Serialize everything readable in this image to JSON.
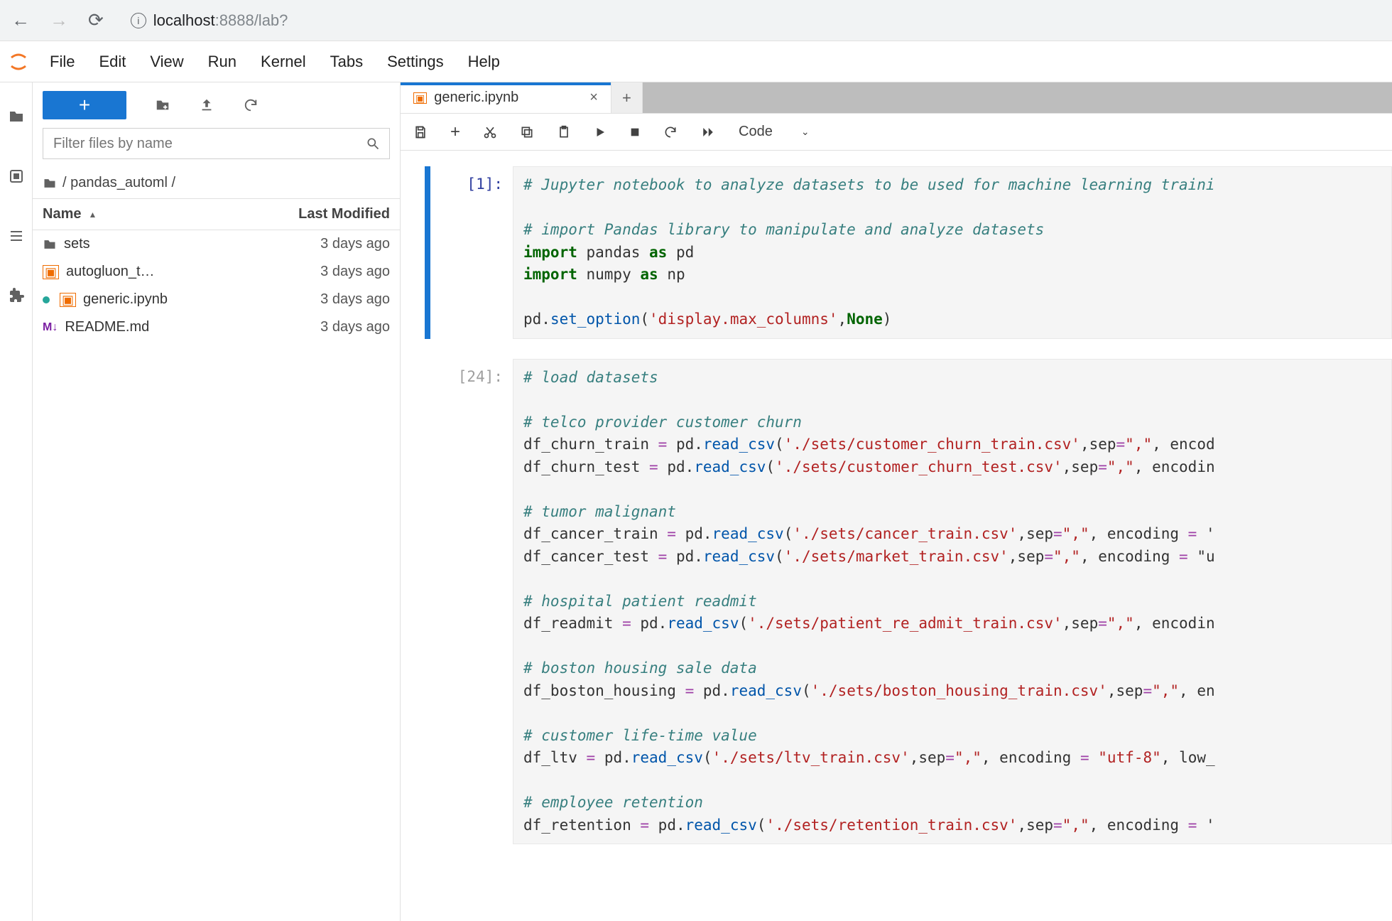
{
  "browser": {
    "url_prefix": "localhost",
    "url_suffix": ":8888/lab?"
  },
  "menu": [
    "File",
    "Edit",
    "View",
    "Run",
    "Kernel",
    "Tabs",
    "Settings",
    "Help"
  ],
  "filebrowser": {
    "filter_placeholder": "Filter files by name",
    "breadcrumb": "/ pandas_automl /",
    "header_name": "Name",
    "header_sort": "▲",
    "header_modified": "Last Modified",
    "items": [
      {
        "icon": "folder",
        "name": "sets",
        "modified": "3 days ago",
        "running": false
      },
      {
        "icon": "notebook",
        "name": "autogluon_t…",
        "modified": "3 days ago",
        "running": false
      },
      {
        "icon": "notebook",
        "name": "generic.ipynb",
        "modified": "3 days ago",
        "running": true
      },
      {
        "icon": "markdown",
        "name": "README.md",
        "modified": "3 days ago",
        "running": false
      }
    ]
  },
  "tab": {
    "title": "generic.ipynb"
  },
  "toolbar": {
    "celltype": "Code"
  },
  "cells": [
    {
      "prompt": "[1]:",
      "selected": true,
      "lines": [
        [
          {
            "cls": "c-comment",
            "t": "# Jupyter notebook to analyze datasets to be used for machine learning traini"
          }
        ],
        [],
        [
          {
            "cls": "c-comment",
            "t": "# import Pandas library to manipulate and analyze datasets"
          }
        ],
        [
          {
            "cls": "c-kw",
            "t": "import"
          },
          {
            "t": " pandas "
          },
          {
            "cls": "c-kw",
            "t": "as"
          },
          {
            "t": " pd"
          }
        ],
        [
          {
            "cls": "c-kw",
            "t": "import"
          },
          {
            "t": " numpy "
          },
          {
            "cls": "c-kw",
            "t": "as"
          },
          {
            "t": " np"
          }
        ],
        [],
        [
          {
            "t": "pd."
          },
          {
            "cls": "c-fn",
            "t": "set_option"
          },
          {
            "t": "("
          },
          {
            "cls": "c-str",
            "t": "'display.max_columns'"
          },
          {
            "t": ","
          },
          {
            "cls": "c-none",
            "t": "None"
          },
          {
            "t": ")"
          }
        ]
      ]
    },
    {
      "prompt": "[24]:",
      "selected": false,
      "lines": [
        [
          {
            "cls": "c-comment",
            "t": "# load datasets"
          }
        ],
        [],
        [
          {
            "cls": "c-comment",
            "t": "# telco provider customer churn"
          }
        ],
        [
          {
            "t": "df_churn_train "
          },
          {
            "cls": "c-op",
            "t": "="
          },
          {
            "t": " pd."
          },
          {
            "cls": "c-fn",
            "t": "read_csv"
          },
          {
            "t": "("
          },
          {
            "cls": "c-str",
            "t": "'./sets/customer_churn_train.csv'"
          },
          {
            "t": ",sep"
          },
          {
            "cls": "c-op",
            "t": "="
          },
          {
            "cls": "c-str",
            "t": "\",\""
          },
          {
            "t": ", encod"
          }
        ],
        [
          {
            "t": "df_churn_test "
          },
          {
            "cls": "c-op",
            "t": "="
          },
          {
            "t": " pd."
          },
          {
            "cls": "c-fn",
            "t": "read_csv"
          },
          {
            "t": "("
          },
          {
            "cls": "c-str",
            "t": "'./sets/customer_churn_test.csv'"
          },
          {
            "t": ",sep"
          },
          {
            "cls": "c-op",
            "t": "="
          },
          {
            "cls": "c-str",
            "t": "\",\""
          },
          {
            "t": ", encodin"
          }
        ],
        [],
        [
          {
            "cls": "c-comment",
            "t": "# tumor malignant"
          }
        ],
        [
          {
            "t": "df_cancer_train "
          },
          {
            "cls": "c-op",
            "t": "="
          },
          {
            "t": " pd."
          },
          {
            "cls": "c-fn",
            "t": "read_csv"
          },
          {
            "t": "("
          },
          {
            "cls": "c-str",
            "t": "'./sets/cancer_train.csv'"
          },
          {
            "t": ",sep"
          },
          {
            "cls": "c-op",
            "t": "="
          },
          {
            "cls": "c-str",
            "t": "\",\""
          },
          {
            "t": ", encoding "
          },
          {
            "cls": "c-op",
            "t": "="
          },
          {
            "t": " '"
          }
        ],
        [
          {
            "t": "df_cancer_test "
          },
          {
            "cls": "c-op",
            "t": "="
          },
          {
            "t": " pd."
          },
          {
            "cls": "c-fn",
            "t": "read_csv"
          },
          {
            "t": "("
          },
          {
            "cls": "c-str",
            "t": "'./sets/market_train.csv'"
          },
          {
            "t": ",sep"
          },
          {
            "cls": "c-op",
            "t": "="
          },
          {
            "cls": "c-str",
            "t": "\",\""
          },
          {
            "t": ", encoding "
          },
          {
            "cls": "c-op",
            "t": "="
          },
          {
            "t": " \"u"
          }
        ],
        [],
        [
          {
            "cls": "c-comment",
            "t": "# hospital patient readmit"
          }
        ],
        [
          {
            "t": "df_readmit "
          },
          {
            "cls": "c-op",
            "t": "="
          },
          {
            "t": " pd."
          },
          {
            "cls": "c-fn",
            "t": "read_csv"
          },
          {
            "t": "("
          },
          {
            "cls": "c-str",
            "t": "'./sets/patient_re_admit_train.csv'"
          },
          {
            "t": ",sep"
          },
          {
            "cls": "c-op",
            "t": "="
          },
          {
            "cls": "c-str",
            "t": "\",\""
          },
          {
            "t": ", encodin"
          }
        ],
        [],
        [
          {
            "cls": "c-comment",
            "t": "# boston housing sale data"
          }
        ],
        [
          {
            "t": "df_boston_housing "
          },
          {
            "cls": "c-op",
            "t": "="
          },
          {
            "t": " pd."
          },
          {
            "cls": "c-fn",
            "t": "read_csv"
          },
          {
            "t": "("
          },
          {
            "cls": "c-str",
            "t": "'./sets/boston_housing_train.csv'"
          },
          {
            "t": ",sep"
          },
          {
            "cls": "c-op",
            "t": "="
          },
          {
            "cls": "c-str",
            "t": "\",\""
          },
          {
            "t": ", en"
          }
        ],
        [],
        [
          {
            "cls": "c-comment",
            "t": "# customer life-time value"
          }
        ],
        [
          {
            "t": "df_ltv "
          },
          {
            "cls": "c-op",
            "t": "="
          },
          {
            "t": " pd."
          },
          {
            "cls": "c-fn",
            "t": "read_csv"
          },
          {
            "t": "("
          },
          {
            "cls": "c-str",
            "t": "'./sets/ltv_train.csv'"
          },
          {
            "t": ",sep"
          },
          {
            "cls": "c-op",
            "t": "="
          },
          {
            "cls": "c-str",
            "t": "\",\""
          },
          {
            "t": ", encoding "
          },
          {
            "cls": "c-op",
            "t": "="
          },
          {
            "t": " "
          },
          {
            "cls": "c-str",
            "t": "\"utf-8\""
          },
          {
            "t": ", low_"
          }
        ],
        [],
        [
          {
            "cls": "c-comment",
            "t": "# employee retention"
          }
        ],
        [
          {
            "t": "df_retention "
          },
          {
            "cls": "c-op",
            "t": "="
          },
          {
            "t": " pd."
          },
          {
            "cls": "c-fn",
            "t": "read_csv"
          },
          {
            "t": "("
          },
          {
            "cls": "c-str",
            "t": "'./sets/retention_train.csv'"
          },
          {
            "t": ",sep"
          },
          {
            "cls": "c-op",
            "t": "="
          },
          {
            "cls": "c-str",
            "t": "\",\""
          },
          {
            "t": ", encoding "
          },
          {
            "cls": "c-op",
            "t": "="
          },
          {
            "t": " '"
          }
        ]
      ]
    }
  ]
}
